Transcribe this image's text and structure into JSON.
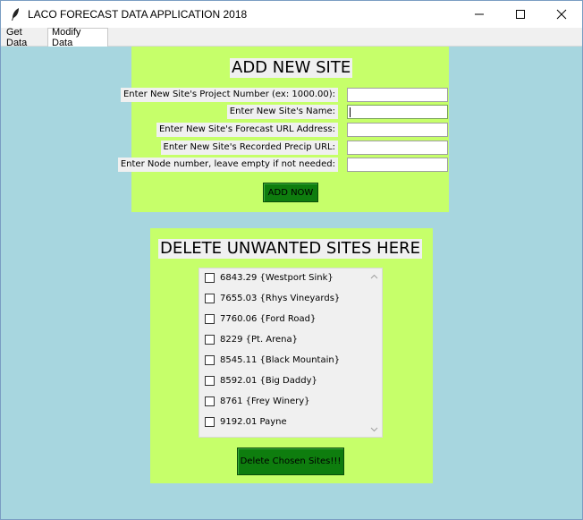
{
  "window": {
    "title": "LACO FORECAST DATA APPLICATION 2018"
  },
  "tabs": [
    {
      "label": "Get Data",
      "active": false
    },
    {
      "label": "Modify Data",
      "active": true
    }
  ],
  "add_site": {
    "heading": "ADD NEW SITE",
    "fields": [
      {
        "label": "Enter New Site's Project Number (ex: 1000.00):",
        "value": ""
      },
      {
        "label": "Enter New Site's Name:",
        "value": ""
      },
      {
        "label": "Enter New Site's Forecast URL Address:",
        "value": ""
      },
      {
        "label": "Enter New Site's Recorded Precip URL:",
        "value": ""
      },
      {
        "label": "Enter Node number, leave empty if not needed:",
        "value": ""
      }
    ],
    "button_label": "ADD NOW"
  },
  "delete_sites": {
    "heading": "DELETE UNWANTED SITES HERE",
    "sites": [
      {
        "label": "6843.29 {Westport Sink}",
        "checked": false
      },
      {
        "label": "7655.03 {Rhys Vineyards}",
        "checked": false
      },
      {
        "label": "7760.06 {Ford Road}",
        "checked": false
      },
      {
        "label": "8229 {Pt. Arena}",
        "checked": false
      },
      {
        "label": "8545.11 {Black Mountain}",
        "checked": false
      },
      {
        "label": "8592.01 {Big Daddy}",
        "checked": false
      },
      {
        "label": "8761 {Frey Winery}",
        "checked": false
      },
      {
        "label": "9192.01 Payne",
        "checked": false
      }
    ],
    "button_label": "Delete Chosen Sites!!!"
  },
  "colors": {
    "background": "#a7d6df",
    "panel": "#c6ff6a",
    "button": "#0e7d0e"
  },
  "icons": [
    "feather-icon",
    "minimize-icon",
    "maximize-icon",
    "close-icon",
    "scroll-up-icon",
    "scroll-down-icon"
  ]
}
